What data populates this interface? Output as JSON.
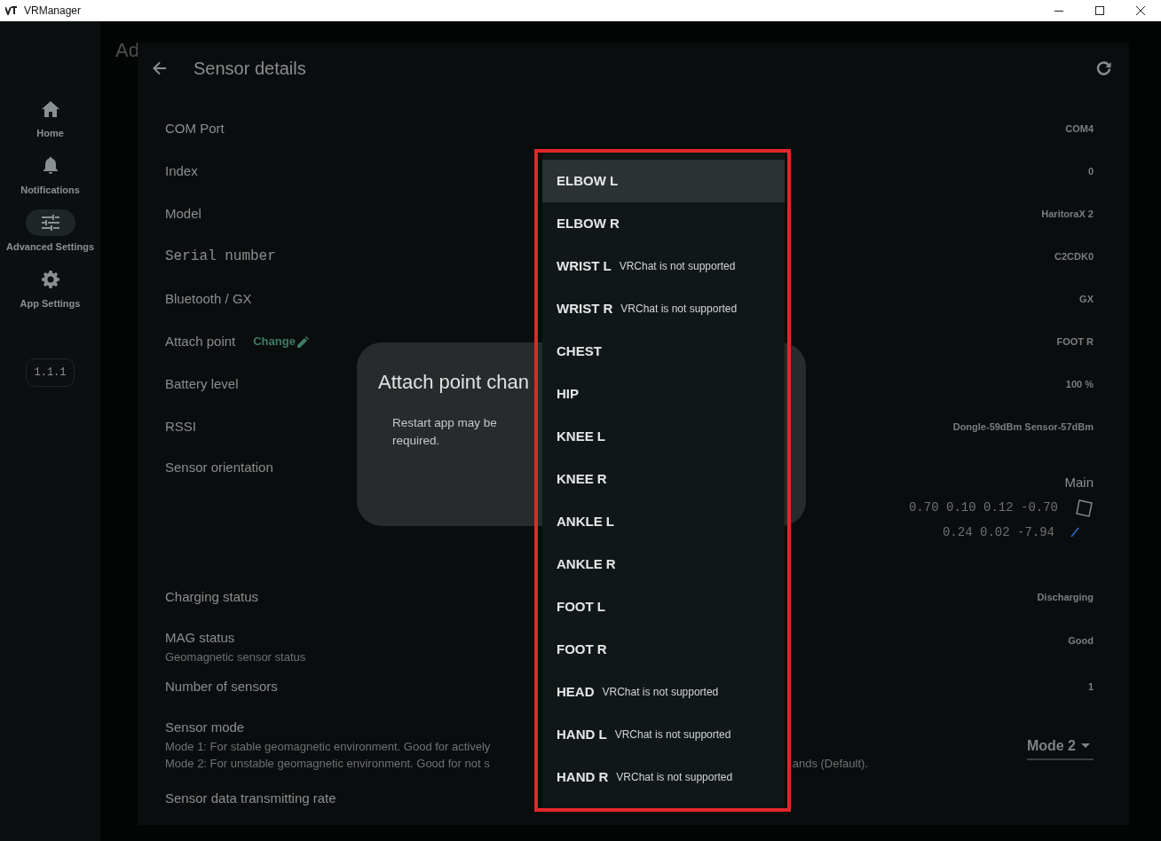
{
  "window": {
    "title": "VRManager"
  },
  "sidebar": {
    "items": [
      {
        "label": "Home",
        "selected": false
      },
      {
        "label": "Notifications",
        "selected": false
      },
      {
        "label": "Advanced Settings",
        "selected": true
      },
      {
        "label": "App Settings",
        "selected": false
      }
    ],
    "version": "1.1.1"
  },
  "background_title": "Ad",
  "panel": {
    "title": "Sensor details",
    "rows": [
      {
        "kind": "text",
        "label": "COM Port",
        "value": "COM4"
      },
      {
        "kind": "text",
        "label": "Index",
        "value": "0"
      },
      {
        "kind": "text",
        "label": "Model",
        "value": "HaritoraX 2"
      },
      {
        "kind": "mono",
        "label": "Serial number",
        "value": "C2CDK0"
      },
      {
        "kind": "text",
        "label": "Bluetooth / GX",
        "value": "GX"
      },
      {
        "kind": "action",
        "label": "Attach point",
        "action": "Change",
        "value": "FOOT R"
      },
      {
        "kind": "text",
        "label": "Battery level",
        "value": "100 %"
      },
      {
        "kind": "text",
        "label": "RSSI",
        "value": "Dongle-59dBm Sensor-57dBm"
      },
      {
        "kind": "orientation",
        "label": "Sensor orientation",
        "caption": "Main",
        "quaternion": "0.70 0.10 0.12 -0.70",
        "vector": "0.24 0.02 -7.94"
      },
      {
        "kind": "text",
        "label": "Charging status",
        "value": "Discharging"
      },
      {
        "kind": "text",
        "label": "MAG status",
        "description": "Geomagnetic sensor status",
        "value": "Good"
      },
      {
        "kind": "text",
        "label": "Number of sensors",
        "value": "1"
      },
      {
        "kind": "select",
        "label": "Sensor mode",
        "description_lines": [
          {
            "left": "Mode 1: For stable geomagnetic environment. Good for actively"
          },
          {
            "left": "Mode 2: For unstable geomagnetic environment. Good for not s",
            "right": "ands (Default)."
          }
        ],
        "value": "Mode 2"
      },
      {
        "kind": "text",
        "label": "Sensor data transmitting rate"
      }
    ]
  },
  "dialog": {
    "title": "Attach point chan",
    "text": "Restart app may be required."
  },
  "menu": {
    "items": [
      {
        "label": "ELBOW L",
        "selected": true
      },
      {
        "label": "ELBOW R",
        "selected": false
      },
      {
        "label": "WRIST L",
        "note": "VRChat is not supported",
        "selected": false
      },
      {
        "label": "WRIST R",
        "note": "VRChat is not supported",
        "selected": false
      },
      {
        "label": "CHEST",
        "selected": false
      },
      {
        "label": "HIP",
        "selected": false
      },
      {
        "label": "KNEE L",
        "selected": false
      },
      {
        "label": "KNEE R",
        "selected": false
      },
      {
        "label": "ANKLE L",
        "selected": false
      },
      {
        "label": "ANKLE R",
        "selected": false
      },
      {
        "label": "FOOT L",
        "selected": false
      },
      {
        "label": "FOOT R",
        "selected": false
      },
      {
        "label": "HEAD",
        "note": "VRChat is not supported",
        "selected": false
      },
      {
        "label": "HAND L",
        "note": "VRChat is not supported",
        "selected": false
      },
      {
        "label": "HAND R",
        "note": "VRChat is not supported",
        "selected": false
      }
    ]
  }
}
